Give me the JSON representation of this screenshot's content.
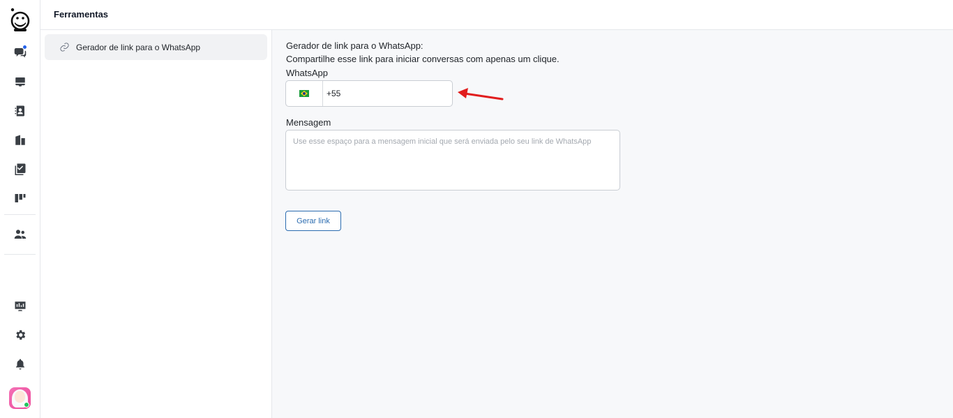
{
  "header": {
    "title": "Ferramentas"
  },
  "rail": {
    "icons": [
      "logo-icon",
      "conversations-icon",
      "inbox-icon",
      "contacts-icon",
      "companies-icon",
      "tasks-icon",
      "kanban-icon",
      "team-icon",
      "monitor-icon",
      "gear-icon",
      "bell-icon"
    ],
    "accent": "#2563eb",
    "status_color": "#22c55e"
  },
  "subnav": {
    "items": [
      {
        "label": "Gerador de link para o WhatsApp",
        "icon": "link-icon"
      }
    ]
  },
  "main": {
    "heading": "Gerador de link para o WhatsApp:",
    "description": "Compartilhe esse link para iniciar conversas com apenas um clique.",
    "whatsapp_label": "WhatsApp",
    "phone_value": "+55",
    "country_flag": "brazil-flag-icon",
    "message_label": "Mensagem",
    "message_placeholder": "Use esse espaço para a mensagem inicial que será enviada pelo seu link de WhatsApp",
    "generate_button": "Gerar link",
    "button_color": "#2b6cb0",
    "annotation_arrow_color": "#e11d1d"
  }
}
